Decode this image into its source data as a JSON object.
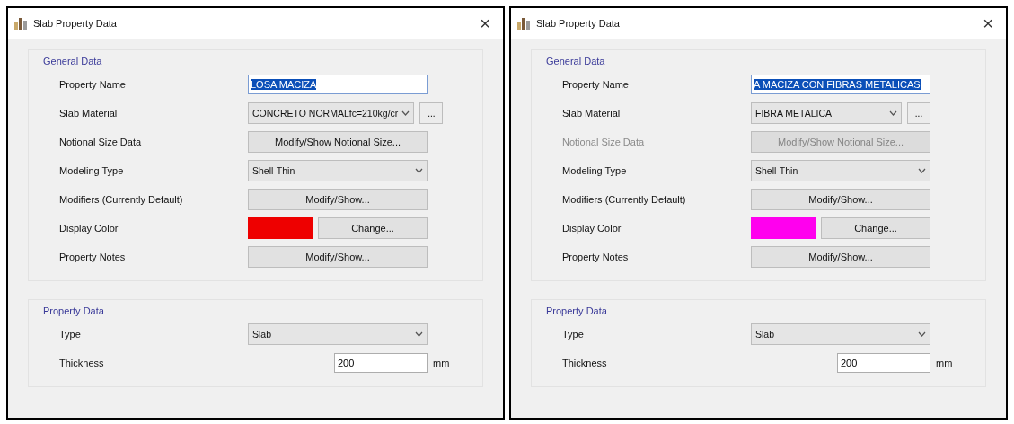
{
  "dialogs": [
    {
      "title": "Slab Property Data",
      "close": "×",
      "general_data": {
        "title": "General Data",
        "rows": [
          {
            "kind": "field",
            "label": "Property Name",
            "value": "LOSA MACIZA",
            "highlighted": true,
            "disabled": false
          },
          {
            "kind": "combo",
            "label": "Slab Material",
            "value": "CONCRETO NORMALfc=210kg/cr",
            "extra_button": "...",
            "disabled": false
          },
          {
            "kind": "button",
            "label": "Notional Size Data",
            "button": "Modify/Show Notional Size...",
            "disabled": false
          },
          {
            "kind": "combo",
            "label": "Modeling Type",
            "value": "Shell-Thin",
            "disabled": false
          },
          {
            "kind": "button",
            "label": "Modifiers (Currently Default)",
            "button": "Modify/Show...",
            "disabled": false
          },
          {
            "kind": "color",
            "label": "Display Color",
            "color": "#ee0000",
            "button": "Change...",
            "disabled": false
          },
          {
            "kind": "button",
            "label": "Property Notes",
            "button": "Modify/Show...",
            "disabled": false
          }
        ]
      },
      "property_data": {
        "title": "Property Data",
        "rows": [
          {
            "kind": "combo",
            "label": "Type",
            "value": "Slab",
            "disabled": false
          },
          {
            "kind": "number",
            "label": "Thickness",
            "value": "200",
            "unit": "mm",
            "disabled": false
          }
        ]
      }
    },
    {
      "title": "Slab Property Data",
      "close": "×",
      "general_data": {
        "title": "General Data",
        "rows": [
          {
            "kind": "field",
            "label": "Property Name",
            "value": "A MACIZA CON FIBRAS METALICAS",
            "highlighted": true,
            "disabled": false
          },
          {
            "kind": "combo",
            "label": "Slab Material",
            "value": "FIBRA METALICA",
            "extra_button": "...",
            "disabled": false
          },
          {
            "kind": "button",
            "label": "Notional Size Data",
            "button": "Modify/Show Notional Size...",
            "disabled": true
          },
          {
            "kind": "combo",
            "label": "Modeling Type",
            "value": "Shell-Thin",
            "disabled": false
          },
          {
            "kind": "button",
            "label": "Modifiers (Currently Default)",
            "button": "Modify/Show...",
            "disabled": false
          },
          {
            "kind": "color",
            "label": "Display Color",
            "color": "#ff00ee",
            "button": "Change...",
            "disabled": false
          },
          {
            "kind": "button",
            "label": "Property Notes",
            "button": "Modify/Show...",
            "disabled": false
          }
        ]
      },
      "property_data": {
        "title": "Property Data",
        "rows": [
          {
            "kind": "combo",
            "label": "Type",
            "value": "Slab",
            "disabled": false
          },
          {
            "kind": "number",
            "label": "Thickness",
            "value": "200",
            "unit": "mm",
            "disabled": false
          }
        ]
      }
    }
  ]
}
